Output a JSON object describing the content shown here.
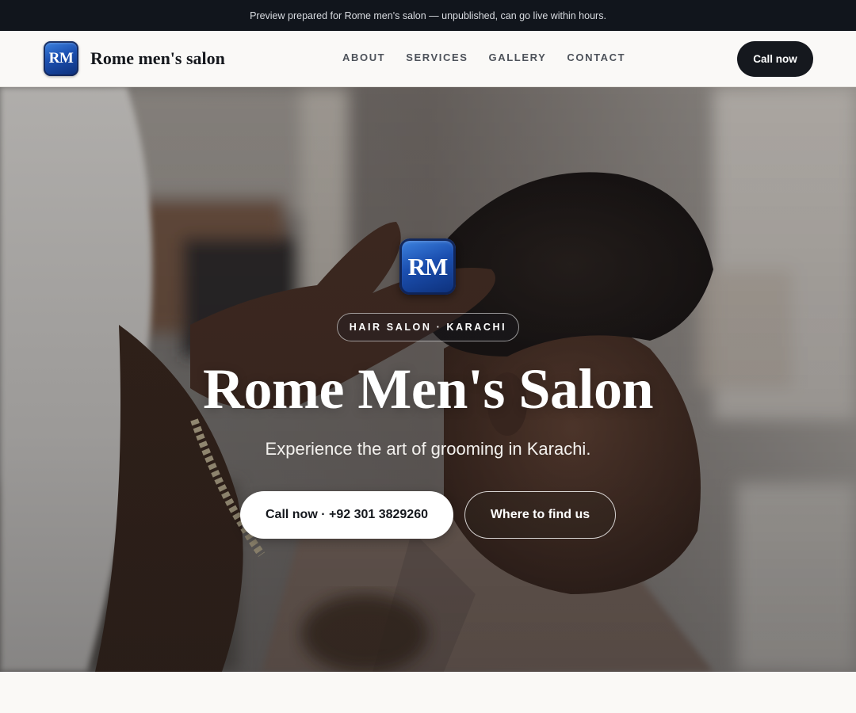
{
  "announcement": "Preview prepared for Rome men's salon — unpublished, can go live within hours.",
  "header": {
    "logo_initials": "RM",
    "brand_name": "Rome men's salon",
    "nav": [
      "ABOUT",
      "SERVICES",
      "GALLERY",
      "CONTACT"
    ],
    "cta_label": "Call now"
  },
  "hero": {
    "logo_initials": "RM",
    "tag": "HAIR SALON · KARACHI",
    "title": "Rome Men's Salon",
    "subtitle": "Experience the art of grooming in Karachi.",
    "primary_button": "Call now · +92 301 3829260",
    "secondary_button": "Where to find us",
    "background": "photo of a barber styling a man's hair in a salon"
  },
  "colors": {
    "topbar": "#11151c",
    "header_bg": "#faf9f7",
    "cta_bg": "#15181e",
    "logo_blue": "#1b4fb0"
  }
}
